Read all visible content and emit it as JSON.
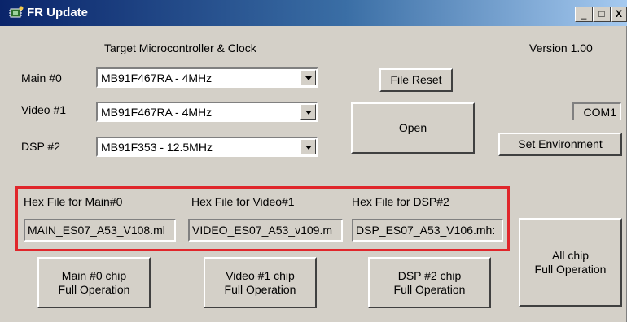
{
  "window": {
    "title": "FR Update"
  },
  "titlebar": {
    "minimize_glyph": "_",
    "maximize_glyph": "□",
    "close_glyph": "X"
  },
  "header": {
    "target_label": "Target Microcontroller & Clock",
    "version": "Version 1.00"
  },
  "rows": [
    {
      "label": "Main #0",
      "selected": "MB91F467RA - 4MHz"
    },
    {
      "label": "Video #1",
      "selected": "MB91F467RA - 4MHz"
    },
    {
      "label": "DSP #2",
      "selected": "MB91F353 - 12.5MHz"
    }
  ],
  "buttons": {
    "file_reset": "File Reset",
    "open": "Open",
    "set_environment": "Set Environment",
    "all_chip_line1": "All chip",
    "all_chip_line2": "Full Operation",
    "main_line1": "Main #0 chip",
    "main_line2": "Full Operation",
    "video_line1": "Video #1 chip",
    "video_line2": "Full Operation",
    "dsp_line1": "DSP #2 chip",
    "dsp_line2": "Full Operation"
  },
  "com_port": "COM1",
  "hex": {
    "main_label": "Hex File for Main#0",
    "video_label": "Hex File for Video#1",
    "dsp_label": "Hex File for DSP#2",
    "main_file": "MAIN_ES07_A53_V108.ml",
    "video_file": "VIDEO_ES07_A53_v109.m",
    "dsp_file": "DSP_ES07_A53_V106.mh:"
  },
  "colors": {
    "highlight_border": "#e0262b",
    "titlebar_start": "#0a246a",
    "titlebar_end": "#a6caf0",
    "face": "#d4d0c8"
  },
  "icons": {
    "app": "chip-app-icon",
    "minimize": "minimize-icon",
    "maximize": "maximize-icon",
    "close": "close-icon",
    "dropdown": "dropdown-arrow-icon"
  }
}
